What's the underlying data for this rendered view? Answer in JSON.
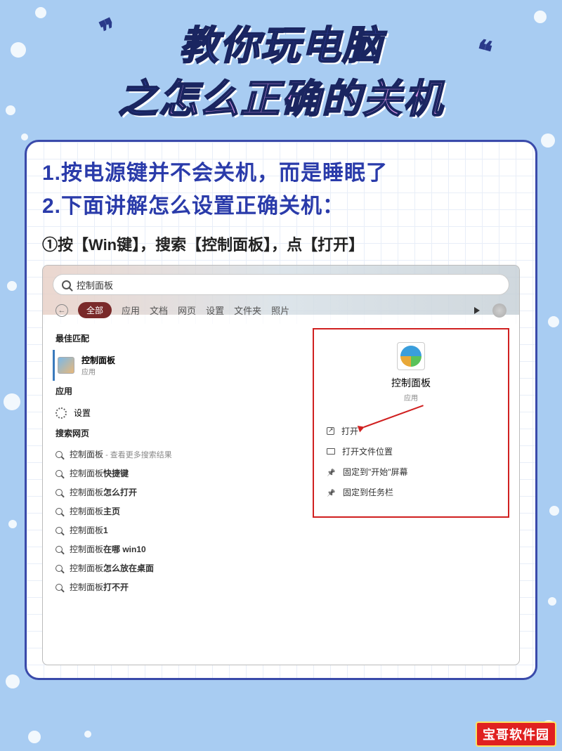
{
  "title": {
    "line1": "教你玩电脑",
    "line2a": "之",
    "line2b": "怎么正确的关机"
  },
  "instructions": {
    "p1": "1.按电源键并不会关机，而是睡眠了",
    "p2": "2.下面讲解怎么设置正确关机：",
    "step1": "①按【Win键】，搜索【控制面板】，点【打开】"
  },
  "search": {
    "query": "控制面板",
    "tabs": [
      "全部",
      "应用",
      "文档",
      "网页",
      "设置",
      "文件夹",
      "照片"
    ],
    "active_tab_index": 0
  },
  "left": {
    "best_match_label": "最佳匹配",
    "best_match": {
      "name": "控制面板",
      "type": "应用"
    },
    "apps_label": "应用",
    "app_item": "设置",
    "web_label": "搜索网页",
    "web_items": [
      {
        "main": "控制面板",
        "suffix": " - 查看更多搜索结果"
      },
      {
        "main": "控制面板",
        "bold": "快捷键"
      },
      {
        "main": "控制面板",
        "bold": "怎么打开"
      },
      {
        "main": "控制面板",
        "bold": "主页"
      },
      {
        "main": "控制面板",
        "bold": "1"
      },
      {
        "main": "控制面板",
        "bold": "在哪 win10"
      },
      {
        "main": "控制面板",
        "bold": "怎么放在桌面"
      },
      {
        "main": "控制面板",
        "bold": "打不开"
      }
    ]
  },
  "right": {
    "name": "控制面板",
    "type": "应用",
    "actions": [
      {
        "icon": "open",
        "label": "打开"
      },
      {
        "icon": "folder",
        "label": "打开文件位置"
      },
      {
        "icon": "pin",
        "label": "固定到\"开始\"屏幕"
      },
      {
        "icon": "pin",
        "label": "固定到任务栏"
      }
    ]
  },
  "badge": "宝哥软件园"
}
